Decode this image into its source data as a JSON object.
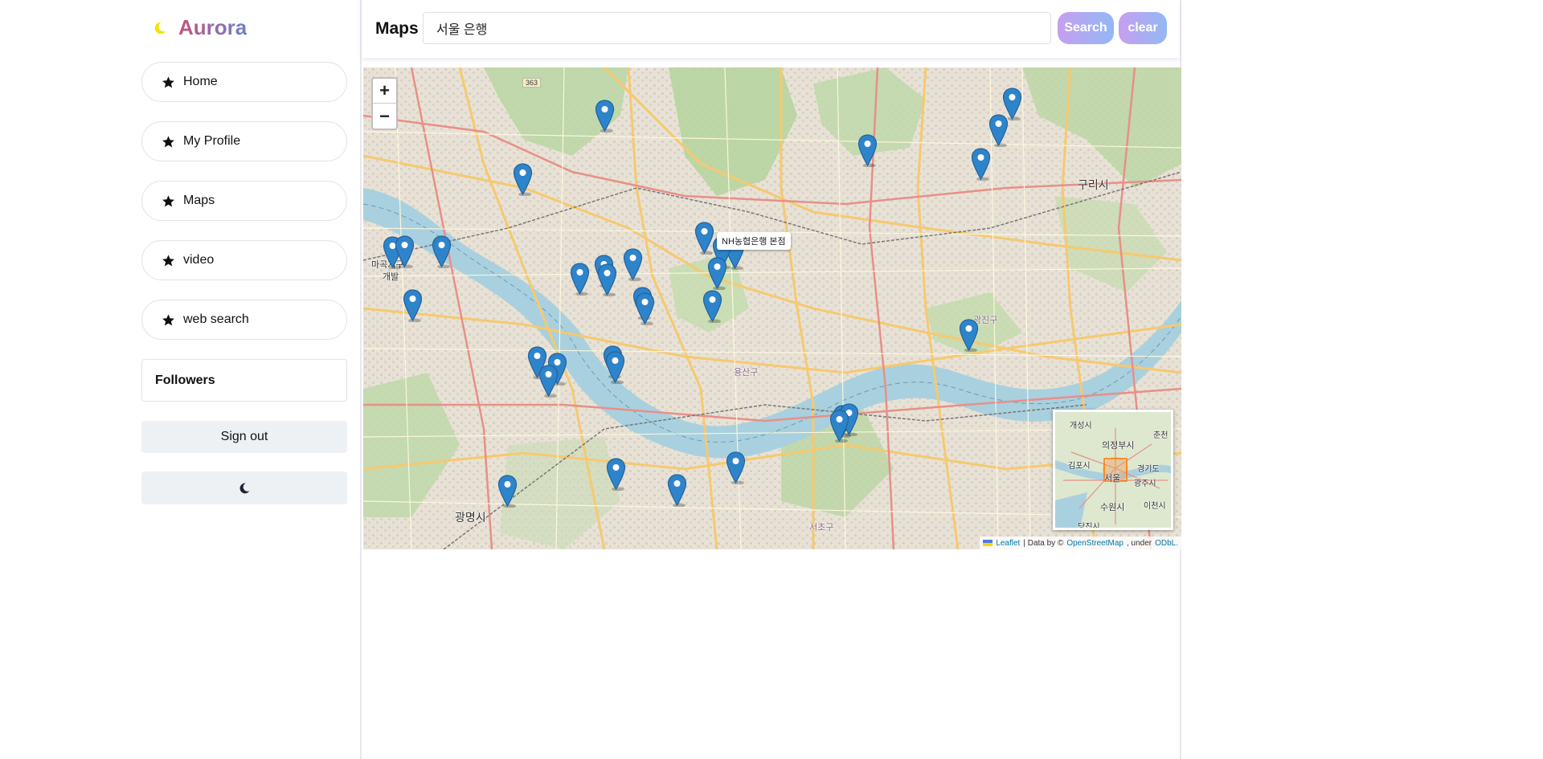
{
  "brand": {
    "title": "Aurora",
    "accent": "#f2e300"
  },
  "nav": [
    {
      "label": "Home",
      "name": "nav-home"
    },
    {
      "label": "My Profile",
      "name": "nav-my-profile"
    },
    {
      "label": "Maps",
      "name": "nav-maps"
    },
    {
      "label": "video",
      "name": "nav-video"
    },
    {
      "label": "web search",
      "name": "nav-web-search"
    }
  ],
  "followers": {
    "label": "Followers"
  },
  "signout": {
    "label": "Sign out"
  },
  "theme_toggle": {
    "icon": "moon-icon"
  },
  "header": {
    "title": "Maps"
  },
  "search": {
    "value": "서울 은행",
    "button": "Search",
    "clear": "clear"
  },
  "map": {
    "zoom_in": "+",
    "zoom_out": "−",
    "tooltip": "NH농협은행 본점",
    "labels": {
      "guri": "구리시",
      "gwangmyeong": "광명시",
      "yongsan": "용산구",
      "seocho": "서초구",
      "gwangjin": "광진구",
      "mapo": "마곡지구",
      "mapo2": "개발",
      "road363": "363"
    },
    "minimap_labels": {
      "gaeseong": "개성시",
      "chuncheon": "춘천",
      "uijeongbu": "의정부시",
      "gimpo": "김포시",
      "gyeonggi": "경기도",
      "seoul": "서울",
      "gwangju": "광주시",
      "suwon": "수원시",
      "icheon": "이천시",
      "dangjin": "당진시"
    },
    "attribution": {
      "leaflet": "Leaflet",
      "data_by": "| Data by ©",
      "osm": "OpenStreetMap",
      "under": ", under",
      "odbl": "ODbL."
    }
  }
}
